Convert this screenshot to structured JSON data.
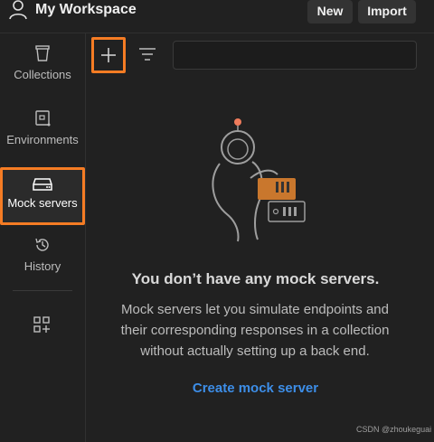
{
  "header": {
    "workspace_title": "My Workspace",
    "new_label": "New",
    "import_label": "Import"
  },
  "sidebar": {
    "items": [
      {
        "label": "Collections",
        "icon": "trash-like-collections-icon"
      },
      {
        "label": "Environments",
        "icon": "environment-icon"
      },
      {
        "label": "Mock servers",
        "icon": "server-icon",
        "active": true
      },
      {
        "label": "History",
        "icon": "history-icon"
      }
    ]
  },
  "empty_state": {
    "title": "You don’t have any mock servers.",
    "description_lines": [
      "Mock servers let you simulate endpoints and",
      "their corresponding responses in a collection",
      "without actually setting up a back end."
    ],
    "create_label": "Create mock server"
  },
  "watermark": "CSDN @zhoukeguai",
  "colors": {
    "highlight": "#f57c24",
    "link": "#3d8ee8",
    "background": "#212121"
  }
}
